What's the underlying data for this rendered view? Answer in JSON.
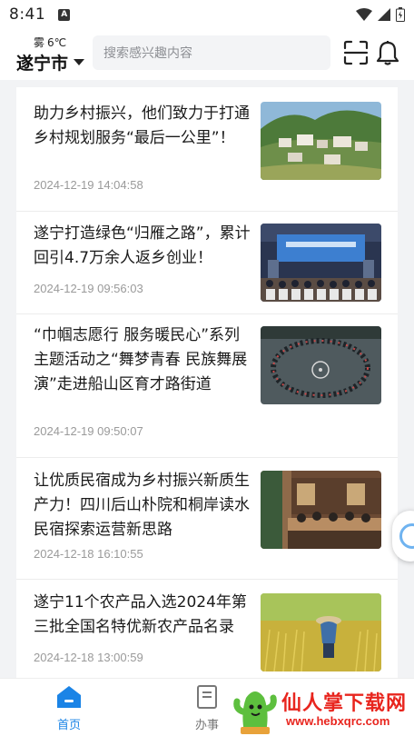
{
  "status_bar": {
    "time": "8:41",
    "notification_glyph": "A"
  },
  "header": {
    "weather_condition": "雾",
    "temperature": "6℃",
    "city": "遂宁市",
    "search_placeholder": "搜索感兴趣内容",
    "icons": [
      "scan-icon",
      "bell-icon"
    ]
  },
  "news": [
    {
      "title": "助力乡村振兴，他们致力于打通乡村规划服务“最后一公里”！",
      "time": "2024-12-19 14:04:58",
      "thumb": "village-landscape"
    },
    {
      "title": "遂宁打造绿色“归雁之路”，累计回引4.7万余人返乡创业！",
      "time": "2024-12-19 09:56:03",
      "thumb": "conference-hall"
    },
    {
      "title": "“巾帼志愿行 服务暖民心”系列主题活动之“舞梦青春 民族舞展演”走进船山区育才路街道",
      "time": "2024-12-19 09:50:07",
      "thumb": "circle-dance"
    },
    {
      "title": "让优质民宿成为乡村振兴新质生产力！四川后山朴院和桐岸读水民宿探索运营新思路",
      "time": "2024-12-18 16:10:55",
      "thumb": "homestay-dinner"
    },
    {
      "title": "遂宁11个农产品入选2024年第三批全国名特优新农产品名录",
      "time": "2024-12-18 13:00:59",
      "thumb": "rice-field-farmer"
    }
  ],
  "bottom_nav": [
    {
      "label": "首页",
      "icon": "home-icon",
      "active": true
    },
    {
      "label": "办事",
      "icon": "document-icon",
      "active": false
    }
  ],
  "watermark": {
    "text": "仙人掌下载网",
    "url": "www.hebxqrc.com"
  },
  "colors": {
    "accent": "#1b84e6",
    "watermark": "#e8251e"
  }
}
